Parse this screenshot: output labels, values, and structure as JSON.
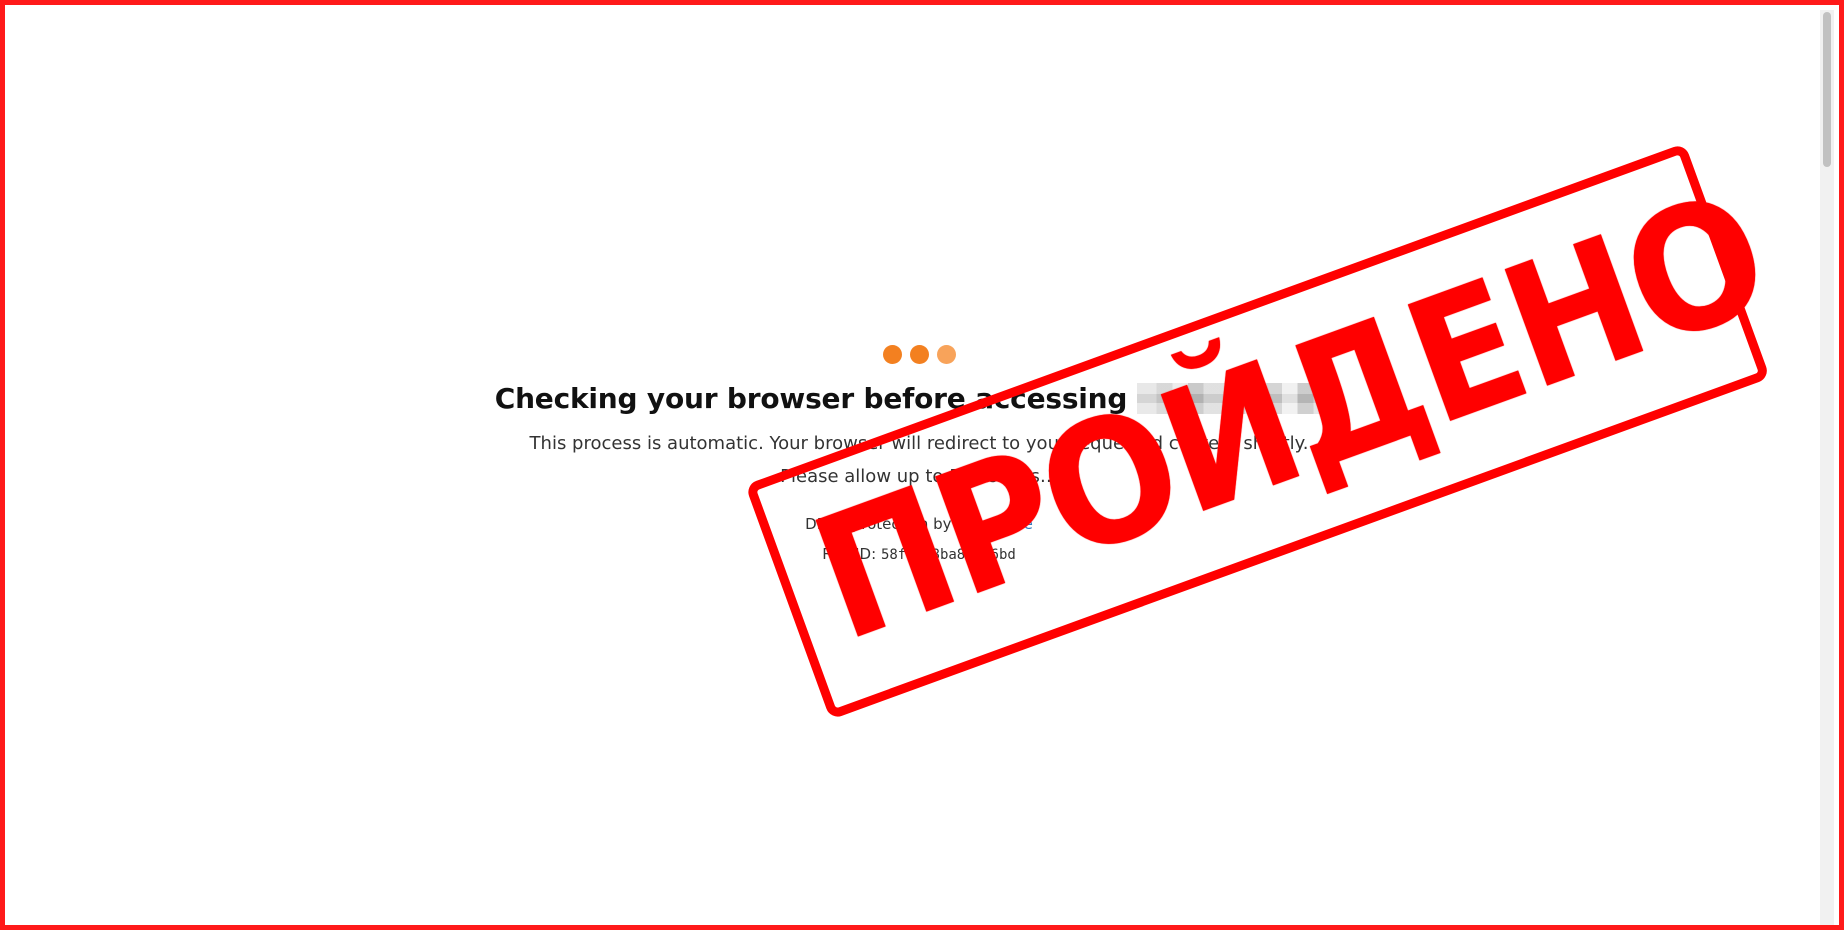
{
  "colors": {
    "frame_border": "#ff1a1a",
    "dot1": "#f38020",
    "dot2": "#f38020",
    "dot3": "#f8a35a",
    "link": "#2f7bbf",
    "stamp": "#ff0000"
  },
  "page": {
    "heading_prefix": "Checking your browser before accessing",
    "heading_suffix": ".",
    "redirect_message": "This process is automatic. Your browser will redirect to your requested content shortly.",
    "allow_message": "Please allow up to 5 seconds…",
    "protection_prefix": "DDoS protection by",
    "protection_link": "Cloudflare",
    "ray_label": "Ray ID:",
    "ray_id": "58f1458ba860d6bd"
  },
  "stamp": {
    "text": "ПРОЙДЕНО"
  }
}
